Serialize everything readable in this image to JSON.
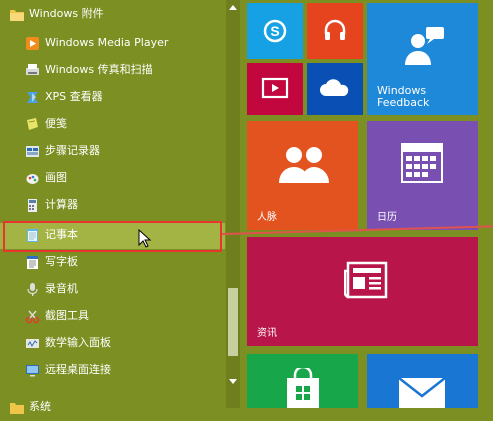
{
  "apps": {
    "folder_label": "Windows 附件",
    "items": [
      {
        "label": "Windows Media Player",
        "icon": "media-player-icon"
      },
      {
        "label": "Windows 传真和扫描",
        "icon": "fax-scan-icon"
      },
      {
        "label": "XPS 查看器",
        "icon": "xps-viewer-icon"
      },
      {
        "label": "便笺",
        "icon": "sticky-notes-icon"
      },
      {
        "label": "步骤记录器",
        "icon": "steps-recorder-icon"
      },
      {
        "label": "画图",
        "icon": "paint-icon"
      },
      {
        "label": "计算器",
        "icon": "calculator-icon"
      },
      {
        "label": "记事本",
        "icon": "notepad-icon"
      },
      {
        "label": "写字板",
        "icon": "wordpad-icon"
      },
      {
        "label": "录音机",
        "icon": "sound-recorder-icon"
      },
      {
        "label": "截图工具",
        "icon": "snipping-tool-icon"
      },
      {
        "label": "数学输入面板",
        "icon": "math-input-icon"
      },
      {
        "label": "远程桌面连接",
        "icon": "remote-desktop-icon"
      }
    ],
    "partial_item_label": "系统"
  },
  "tiles": {
    "feedback": "Windows Feedback",
    "people": "人脉",
    "calendar": "日历",
    "news": "资讯"
  },
  "colors": {
    "background": "#7c8f22",
    "skype": "#16a1e4",
    "music": "#e5441e",
    "video": "#c2073f",
    "onedrive": "#0a4fb4",
    "feedback": "#1e88d9",
    "people": "#e2531f",
    "calendar": "#7a4fb2",
    "news": "#b8154a",
    "store": "#17a64a",
    "mail": "#1976d2",
    "selection_box": "#e8352f"
  }
}
